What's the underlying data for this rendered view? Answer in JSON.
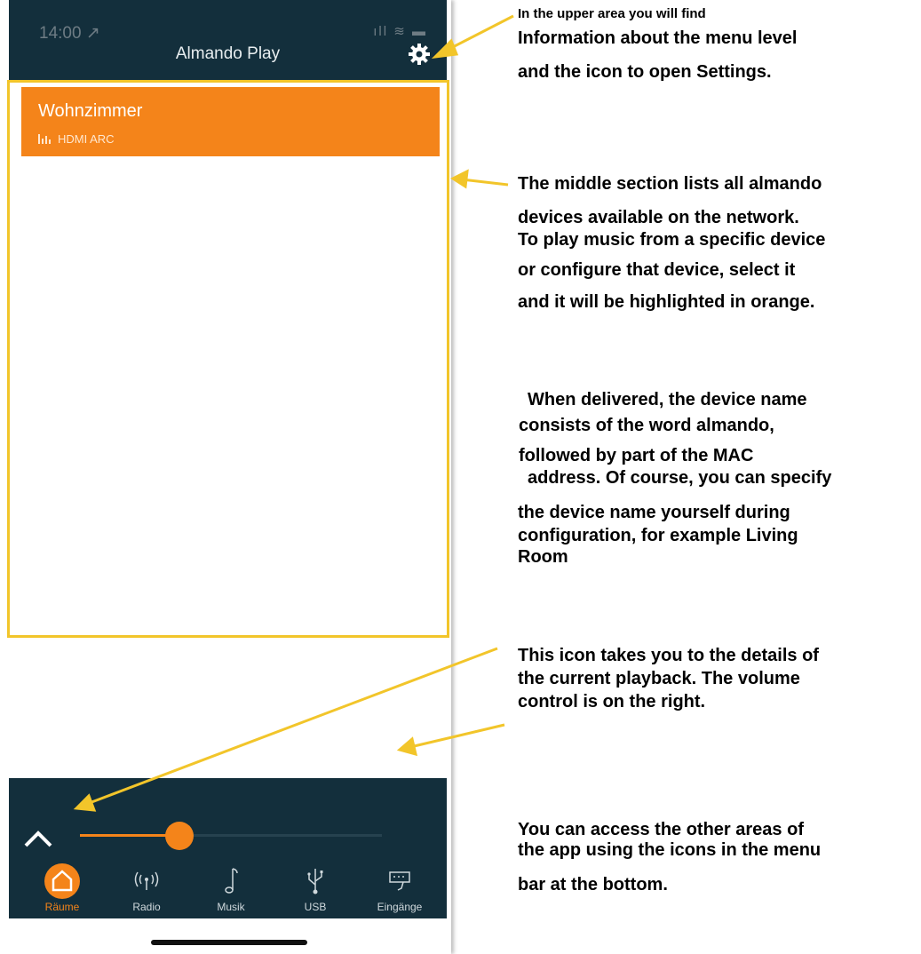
{
  "status": {
    "time": "14:00 ↗",
    "icons": "ıll ≋ ▬"
  },
  "header": {
    "title": "Almando Play"
  },
  "devices": [
    {
      "name": "Wohnzimmer",
      "source": "HDMI ARC",
      "selected": true
    }
  ],
  "player": {
    "volume": 0.33
  },
  "tabs": [
    {
      "label": "Räume",
      "icon": "home-icon",
      "active": true
    },
    {
      "label": "Radio",
      "icon": "radio-icon",
      "active": false
    },
    {
      "label": "Musik",
      "icon": "music-note-icon",
      "active": false
    },
    {
      "label": "USB",
      "icon": "usb-icon",
      "active": false
    },
    {
      "label": "Eingänge",
      "icon": "inputs-icon",
      "active": false
    }
  ],
  "annotations": {
    "top_small": "In the upper area you will find",
    "top_line1": "Information about the menu level",
    "top_line2": "and the icon to open Settings.",
    "middle_line1": "The middle section lists all almando",
    "middle_line2": "devices available on the network.",
    "middle_line3": "To play music from a specific device",
    "middle_line4": "or configure that device, select it",
    "middle_line5": "and it will be highlighted in orange.",
    "name_line1": "When delivered, the device name",
    "name_line2": "consists of the word almando,",
    "name_line3": "followed by part of the MAC",
    "name_line4": "address. Of course, you can specify",
    "name_line5": "the device name yourself during",
    "name_line6": "configuration, for example Living",
    "name_line7": "Room",
    "icon_line1": "This icon takes you to the details of",
    "icon_line2": "the current playback. The volume",
    "icon_line3": "control is on the right.",
    "menu_line1": "You can access the other areas of",
    "menu_line2": "the app using the icons in the menu",
    "menu_line3": "bar at the bottom."
  },
  "colors": {
    "bar": "#132f3c",
    "accent": "#f4841a",
    "highlight": "#f2c52a"
  }
}
